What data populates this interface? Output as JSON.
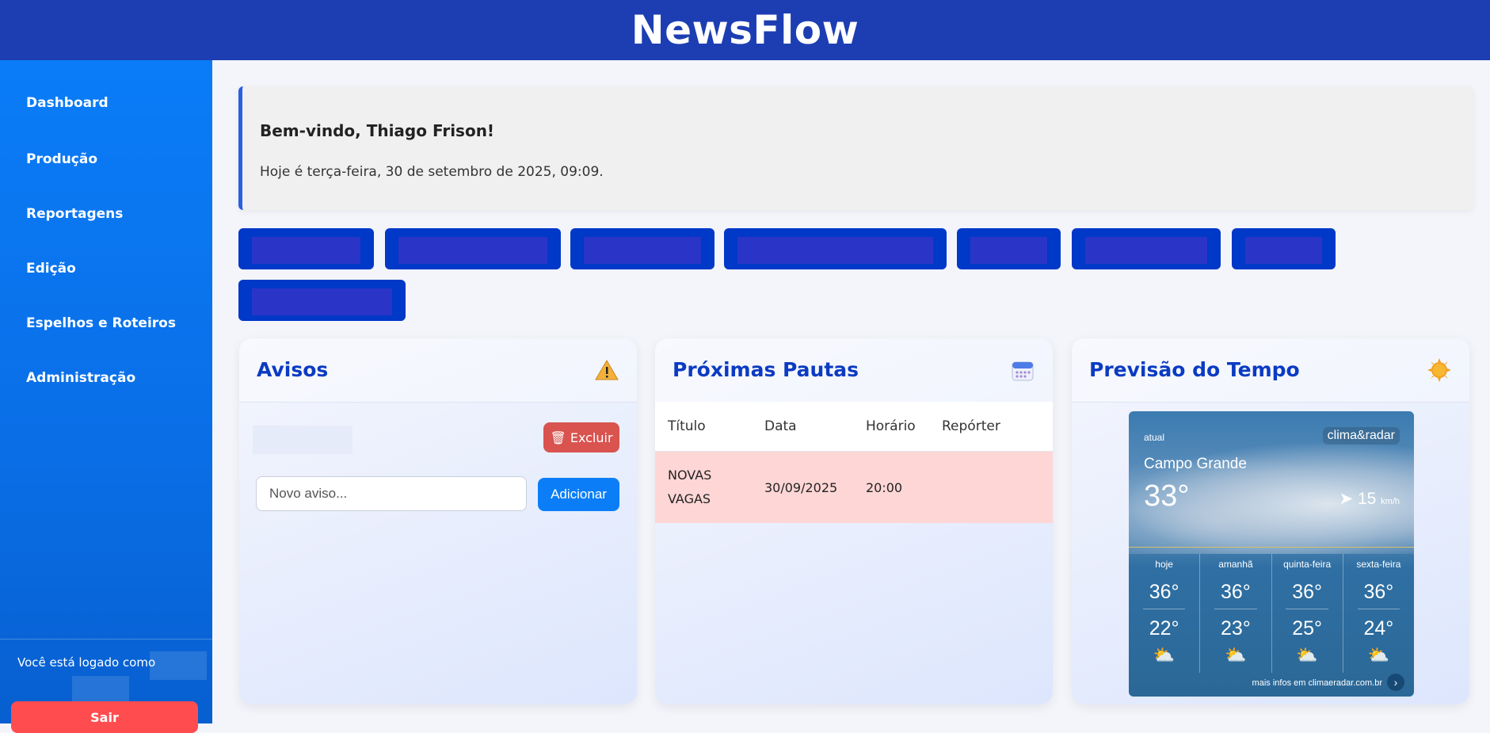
{
  "app": {
    "brand": "NewsFlow"
  },
  "sidebar": {
    "items": [
      {
        "label": "Dashboard"
      },
      {
        "label": "Produção"
      },
      {
        "label": "Reportagens"
      },
      {
        "label": "Edição"
      },
      {
        "label": "Espelhos e Roteiros"
      },
      {
        "label": "Administração"
      }
    ],
    "logged_as": "Você está logado como",
    "logout_label": "Sair"
  },
  "welcome": {
    "title": "Bem-vindo, Thiago Frison!",
    "date_text": "Hoje é terça-feira, 30 de setembro de 2025, 09:09."
  },
  "avisos": {
    "title": "Avisos",
    "icon": "warning-icon",
    "delete_label": "🗑 Excluir",
    "input_placeholder": "Novo aviso...",
    "add_label": "Adicionar"
  },
  "pautas": {
    "title": "Próximas Pautas",
    "icon": "calendar-icon",
    "columns": [
      "Título",
      "Data",
      "Horário",
      "Repórter"
    ],
    "rows": [
      {
        "titulo": "NOVAS VAGAS",
        "data": "30/09/2025",
        "horario": "20:00",
        "reporter": ""
      }
    ]
  },
  "tempo": {
    "title": "Previsão do Tempo",
    "icon": "sun-icon",
    "widget": {
      "label_atual": "atual",
      "logo": "clima&radar",
      "city": "Campo Grande",
      "temp": "33°",
      "wind": "15",
      "wind_unit": "km/h",
      "days": [
        {
          "name": "hoje",
          "max": "36°",
          "min": "22°"
        },
        {
          "name": "amanhã",
          "max": "36°",
          "min": "23°"
        },
        {
          "name": "quinta-feira",
          "max": "36°",
          "min": "25°"
        },
        {
          "name": "sexta-feira",
          "max": "36°",
          "min": "24°"
        }
      ],
      "more": "mais infos em climaeradar.com.br"
    }
  },
  "colors": {
    "topbar": "#1d3eb3",
    "sidebar": "#0a7cf7",
    "accent_title": "#0b3bc2",
    "danger": "#d9534f",
    "primary": "#0b7ef7"
  }
}
